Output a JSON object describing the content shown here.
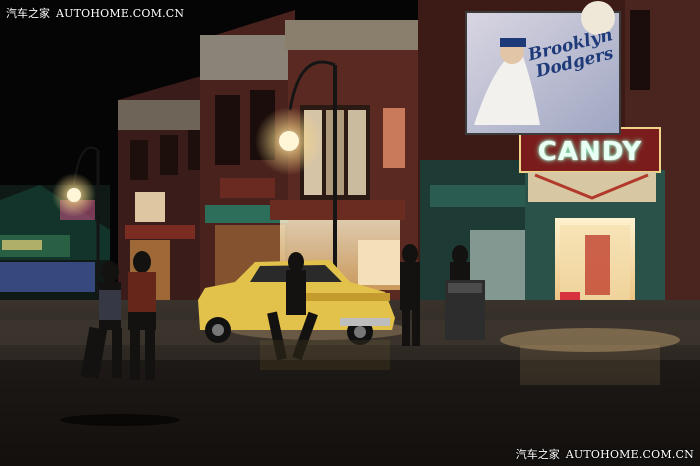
{
  "watermarks": {
    "top_left": {
      "cn": "汽车之家",
      "en": "AUTOHOME.COM.CN"
    },
    "bottom_right": {
      "cn": "汽车之家",
      "en": "AUTOHOME.COM.CN"
    }
  },
  "storefront": {
    "sign_text": "CANDY"
  },
  "billboard": {
    "line1": "Brooklyn",
    "line2": "Dodgers"
  },
  "colors": {
    "sky": "#050506",
    "brick": "#5a2a22",
    "taxi": "#e2c24a",
    "neon_sign": "#7dffc8",
    "street_glow": "#f2c88a",
    "pavement": "#2a2622"
  }
}
